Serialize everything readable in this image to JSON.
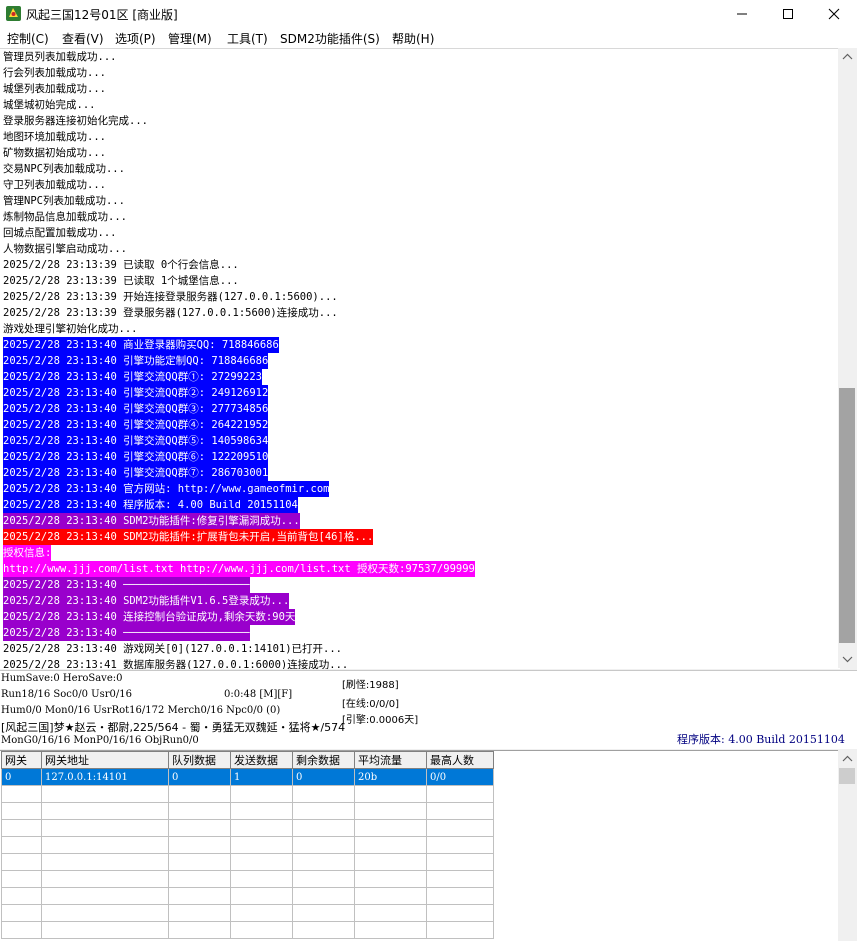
{
  "window": {
    "title": "风起三国12号01区 [商业版]"
  },
  "menu": [
    "控制(C)",
    "查看(V)",
    "选项(P)",
    "管理(M)",
    "工具(T)",
    "SDM2功能插件(S)",
    "帮助(H)"
  ],
  "colors": {
    "blue_highlight": "#0000ff",
    "purple_highlight": "#9900cc",
    "red_highlight": "#ff0000",
    "magenta_highlight": "#ff00ff",
    "selection": "#0078d7",
    "version_text": "#000080"
  },
  "log_lines": [
    {
      "text": "管理员列表加载成功...",
      "style": "normal"
    },
    {
      "text": "行会列表加载成功...",
      "style": "normal"
    },
    {
      "text": "城堡列表加载成功...",
      "style": "normal"
    },
    {
      "text": "城堡城初始完成...",
      "style": "normal"
    },
    {
      "text": "登录服务器连接初始化完成...",
      "style": "normal"
    },
    {
      "text": "地图环境加载成功...",
      "style": "normal"
    },
    {
      "text": "矿物数据初始成功...",
      "style": "normal"
    },
    {
      "text": "交易NPC列表加载成功...",
      "style": "normal"
    },
    {
      "text": "守卫列表加载成功...",
      "style": "normal"
    },
    {
      "text": "管理NPC列表加载成功...",
      "style": "normal"
    },
    {
      "text": "炼制物品信息加载成功...",
      "style": "normal"
    },
    {
      "text": "回城点配置加载成功...",
      "style": "normal"
    },
    {
      "text": "人物数据引擎启动成功...",
      "style": "normal"
    },
    {
      "text": "2025/2/28 23:13:39 已读取 0个行会信息...",
      "style": "normal"
    },
    {
      "text": "2025/2/28 23:13:39 已读取 1个城堡信息...",
      "style": "normal"
    },
    {
      "text": "2025/2/28 23:13:39 开始连接登录服务器(127.0.0.1:5600)...",
      "style": "normal"
    },
    {
      "text": "2025/2/28 23:13:39 登录服务器(127.0.0.1:5600)连接成功...",
      "style": "normal"
    },
    {
      "text": "游戏处理引擎初始化成功...",
      "style": "normal"
    },
    {
      "text": "2025/2/28 23:13:40 商业登录器购买QQ: 718846686",
      "style": "blue"
    },
    {
      "text": "2025/2/28 23:13:40 引擎功能定制QQ: 718846686",
      "style": "blue"
    },
    {
      "text": "2025/2/28 23:13:40 引擎交流QQ群①: 27299223",
      "style": "blue"
    },
    {
      "text": "2025/2/28 23:13:40 引擎交流QQ群②: 249126912",
      "style": "blue"
    },
    {
      "text": "2025/2/28 23:13:40 引擎交流QQ群③: 277734856",
      "style": "blue"
    },
    {
      "text": "2025/2/28 23:13:40 引擎交流QQ群④: 264221952",
      "style": "blue"
    },
    {
      "text": "2025/2/28 23:13:40 引擎交流QQ群⑤: 140598634",
      "style": "blue"
    },
    {
      "text": "2025/2/28 23:13:40 引擎交流QQ群⑥: 122209510",
      "style": "blue"
    },
    {
      "text": "2025/2/28 23:13:40 引擎交流QQ群⑦: 286703001",
      "style": "blue"
    },
    {
      "text": "2025/2/28 23:13:40 官方网站: http://www.gameofmir.com",
      "style": "blue"
    },
    {
      "text": "2025/2/28 23:13:40 程序版本: 4.00 Build 20151104",
      "style": "blue"
    },
    {
      "text": "2025/2/28 23:13:40 SDM2功能插件:修复引擎漏洞成功...",
      "style": "purple"
    },
    {
      "text": "2025/2/28 23:13:40 SDM2功能插件:扩展背包未开启,当前背包[46]格...",
      "style": "red"
    },
    {
      "text": "授权信息:",
      "style": "magenta"
    },
    {
      "text": "http://www.jjj.com/list.txt http://www.jjj.com/list.txt 授权天数:97537/99999",
      "style": "magenta"
    },
    {
      "text": "2025/2/28 23:13:40 ────────────────────",
      "style": "purple"
    },
    {
      "text": "2025/2/28 23:13:40 SDM2功能插件V1.6.5登录成功...",
      "style": "purple"
    },
    {
      "text": "2025/2/28 23:13:40 连接控制台验证成功,剩余天数:90天",
      "style": "purple"
    },
    {
      "text": "2025/2/28 23:13:40 ────────────────────",
      "style": "purple"
    },
    {
      "text": "2025/2/28 23:13:40 游戏网关[0](127.0.0.1:14101)已打开...",
      "style": "normal"
    },
    {
      "text": "2025/2/28 23:13:41 数据库服务器(127.0.0.1:6000)连接成功...",
      "style": "normal"
    }
  ],
  "status": {
    "line1": "HumSave:0 HeroSave:0",
    "line2": "Run18/16 Soc0/0 Usr0/16",
    "timer": "0:0:48 [M][F]",
    "line3": "Hum0/0 Mon0/16 UsrRot16/172 Merch0/16 Npc0/0 (0)",
    "line4": "[风起三国]梦★赵云・都尉,225/564 - 蜀・勇猛无双魏延・猛将★/574",
    "line5": "MonG0/16/16 MonP0/16/16 ObjRun0/0",
    "refresh": "[刷怪:1988]",
    "online": "[在线:0/0/0]",
    "engine": "[引擎:0.0006天]",
    "version": "程序版本: 4.00 Build 20151104"
  },
  "gateway_table": {
    "headers": [
      "网关",
      "网关地址",
      "队列数据",
      "发送数据",
      "剩余数据",
      "平均流量",
      "最高人数"
    ],
    "rows": [
      [
        "0",
        "127.0.0.1:14101",
        "0",
        "1",
        "0",
        "20b",
        "0/0"
      ]
    ],
    "empty_rows": 9
  }
}
